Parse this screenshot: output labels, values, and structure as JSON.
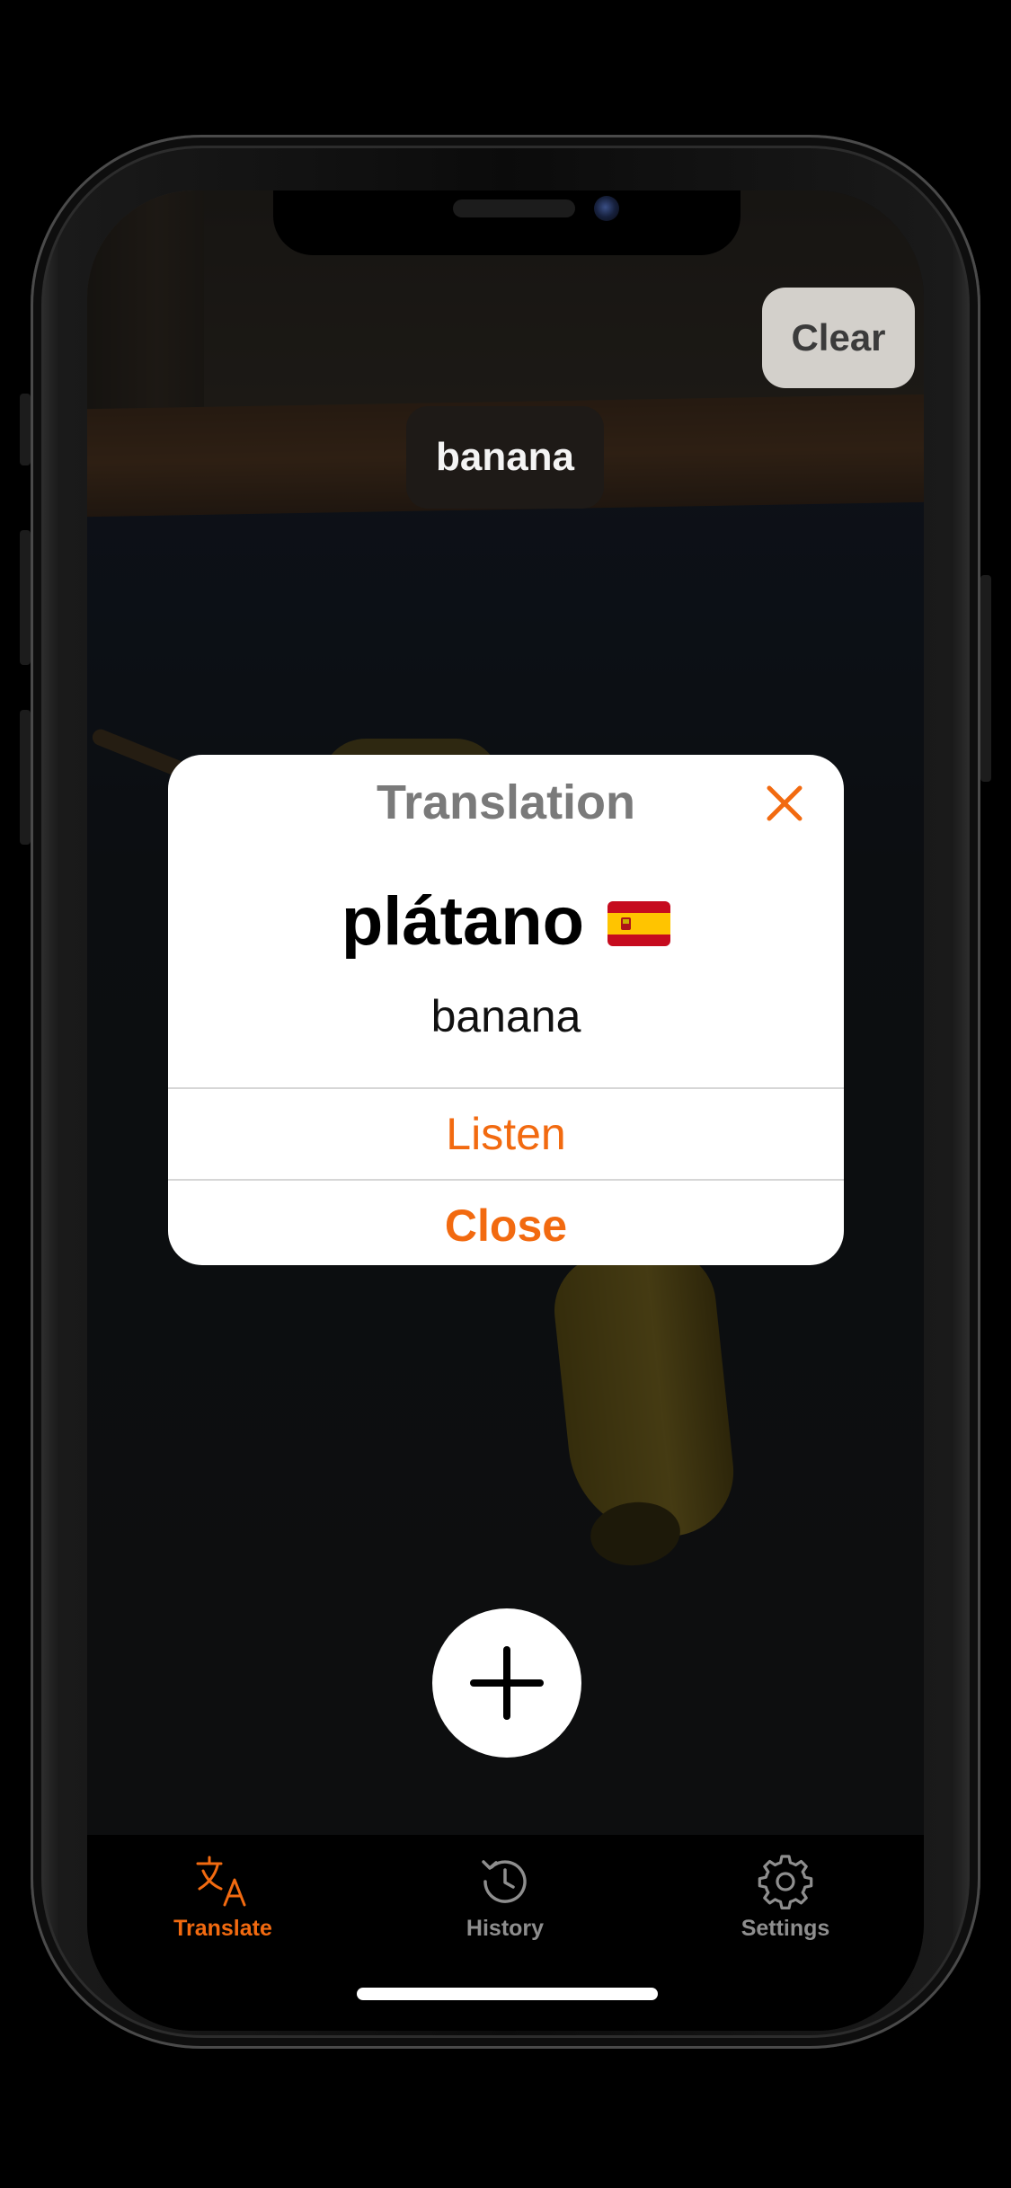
{
  "top_overlay": {
    "clear_label": "Clear",
    "detected_label": "banana"
  },
  "dialog": {
    "title": "Translation",
    "close_icon": "close-x-icon",
    "translated_word": "plátano",
    "flag": "spain-flag",
    "source_word": "banana",
    "listen_label": "Listen",
    "close_label": "Close"
  },
  "add_button": {
    "icon": "plus-icon"
  },
  "tabbar": {
    "tabs": [
      {
        "label": "Translate",
        "icon": "translate-icon",
        "active": true
      },
      {
        "label": "History",
        "icon": "history-icon",
        "active": false
      },
      {
        "label": "Settings",
        "icon": "gear-icon",
        "active": false
      }
    ]
  },
  "colors": {
    "accent": "#f26a10",
    "inactive": "#8e8e8e",
    "dialog_title": "#7a7a7a"
  }
}
